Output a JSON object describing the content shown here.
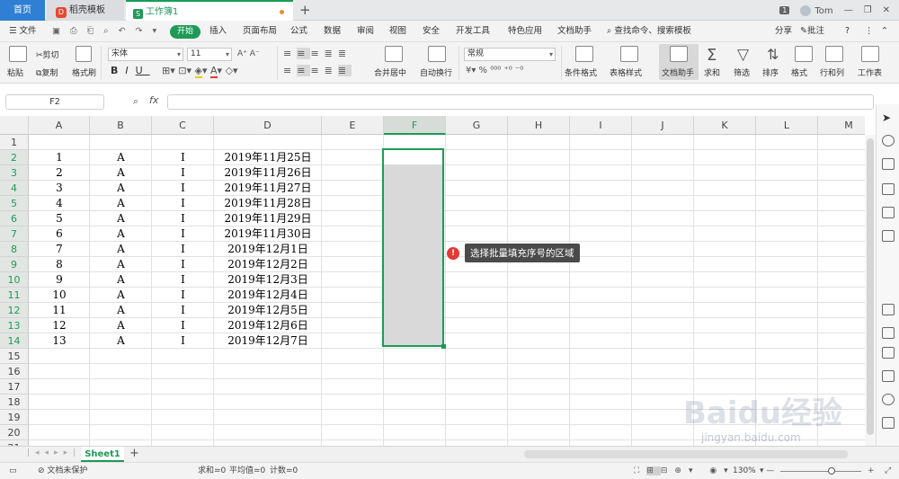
{
  "tabs": {
    "home": "首页",
    "templates": "稻壳模板",
    "workbook": "工作簿1",
    "new_tab": "+"
  },
  "window": {
    "badge": "1",
    "user": "Tom"
  },
  "menu": {
    "file": "文件",
    "start": "开始",
    "items": [
      "插入",
      "页面布局",
      "公式",
      "数据",
      "审阅",
      "视图",
      "安全",
      "开发工具",
      "特色应用",
      "文档助手"
    ],
    "search": "查找命令、搜索模板",
    "share": "分享",
    "comment": "批注",
    "help": "?"
  },
  "toolbar": {
    "paste": "粘贴",
    "cut": "剪切",
    "copy": "复制",
    "format_painter": "格式刷",
    "font_name": "宋体",
    "font_size": "11",
    "merge_center": "合并居中",
    "wrap_text": "自动换行",
    "number_format": "常规",
    "conditional_format": "条件格式",
    "table_style": "表格样式",
    "doc_assistant": "文档助手",
    "sum": "求和",
    "filter": "筛选",
    "sort": "排序",
    "format": "格式",
    "rows_cols": "行和列",
    "worksheet": "工作表"
  },
  "formula_bar": {
    "name_box": "F2",
    "fx": "fx",
    "value": ""
  },
  "columns": [
    "A",
    "B",
    "C",
    "D",
    "E",
    "F",
    "G",
    "H",
    "I",
    "J",
    "K",
    "L",
    "M"
  ],
  "rows": [
    "1",
    "2",
    "3",
    "4",
    "5",
    "6",
    "7",
    "8",
    "9",
    "10",
    "11",
    "12",
    "13",
    "14",
    "15",
    "16",
    "17",
    "18",
    "19",
    "20",
    "21"
  ],
  "table": [
    [
      "1",
      "A",
      "I",
      "2019年11月25日"
    ],
    [
      "2",
      "A",
      "I",
      "2019年11月26日"
    ],
    [
      "3",
      "A",
      "I",
      "2019年11月27日"
    ],
    [
      "4",
      "A",
      "I",
      "2019年11月28日"
    ],
    [
      "5",
      "A",
      "I",
      "2019年11月29日"
    ],
    [
      "6",
      "A",
      "I",
      "2019年11月30日"
    ],
    [
      "7",
      "A",
      "I",
      "2019年12月1日"
    ],
    [
      "8",
      "A",
      "I",
      "2019年12月2日"
    ],
    [
      "9",
      "A",
      "I",
      "2019年12月3日"
    ],
    [
      "10",
      "A",
      "I",
      "2019年12月4日"
    ],
    [
      "11",
      "A",
      "I",
      "2019年12月5日"
    ],
    [
      "12",
      "A",
      "I",
      "2019年12月6日"
    ],
    [
      "13",
      "A",
      "I",
      "2019年12月7日"
    ]
  ],
  "selection": {
    "range": "F2:F14",
    "active_cell": "F2"
  },
  "annotation": {
    "number": "!",
    "text": "选择批量填充序号的区域"
  },
  "sheets": {
    "active": "Sheet1",
    "add": "+"
  },
  "status": {
    "doc_protect": "文档未保护",
    "sum": "求和=0",
    "average": "平均值=0",
    "count": "计数=0",
    "zoom": "130%"
  },
  "watermark": {
    "brand": "Baidu经验",
    "url": "jingyan.baidu.com"
  },
  "colors": {
    "accent": "#1d9a57",
    "home_tab": "#2f7fd5",
    "callout_badge": "#e53935"
  }
}
